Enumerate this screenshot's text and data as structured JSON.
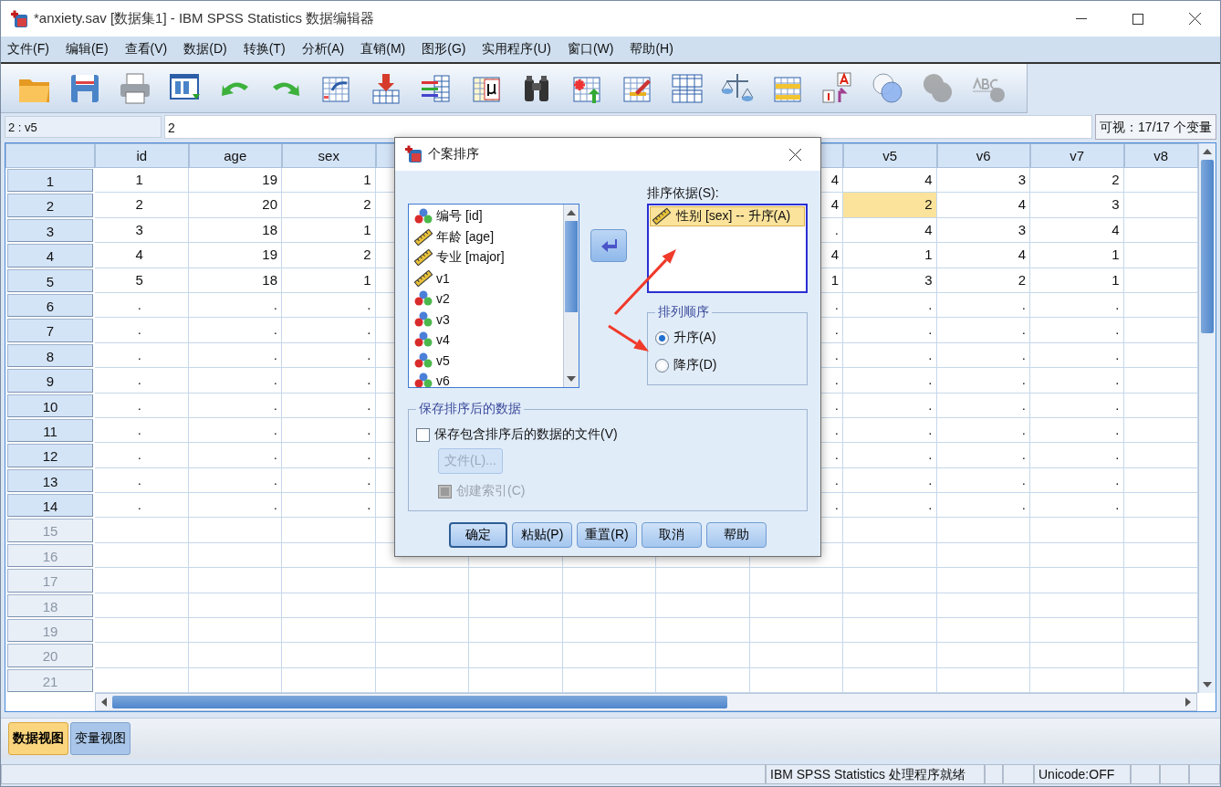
{
  "window": {
    "title": "*anxiety.sav [数据集1] - IBM SPSS Statistics 数据编辑器"
  },
  "menu": [
    "文件(F)",
    "编辑(E)",
    "查看(V)",
    "数据(D)",
    "转换(T)",
    "分析(A)",
    "直销(M)",
    "图形(G)",
    "实用程序(U)",
    "窗口(W)",
    "帮助(H)"
  ],
  "toolbar": [
    {
      "kind": "folder",
      "disabled": false
    },
    {
      "kind": "save",
      "disabled": false
    },
    {
      "kind": "print",
      "disabled": false
    },
    {
      "kind": "recall",
      "disabled": false
    },
    {
      "kind": "undo",
      "disabled": false
    },
    {
      "kind": "redo",
      "disabled": false
    },
    {
      "kind": "goto-case",
      "disabled": false
    },
    {
      "kind": "goto-variable",
      "disabled": false
    },
    {
      "kind": "variables",
      "disabled": false
    },
    {
      "kind": "mu",
      "disabled": false
    },
    {
      "kind": "find",
      "disabled": false
    },
    {
      "kind": "insert-case",
      "disabled": false
    },
    {
      "kind": "insert-variable",
      "disabled": false
    },
    {
      "kind": "split",
      "disabled": false
    },
    {
      "kind": "weight",
      "disabled": false
    },
    {
      "kind": "select",
      "disabled": false
    },
    {
      "kind": "labels",
      "disabled": false
    },
    {
      "kind": "sets",
      "disabled": false
    },
    {
      "kind": "sets-all",
      "disabled": true
    },
    {
      "kind": "spell",
      "disabled": true
    }
  ],
  "cell_editor": {
    "cell_name": "2 : v5",
    "value": "2",
    "visible_count": "可视：17/17 个变量"
  },
  "table": {
    "columns": [
      "id",
      "age",
      "sex",
      null,
      null,
      null,
      null,
      null,
      "v5",
      "v6",
      "v7",
      "v8"
    ],
    "rows": [
      {
        "number": "1",
        "kind": "data",
        "cells": [
          "1",
          "19",
          "1",
          null,
          null,
          null,
          null,
          "4",
          "4",
          "3",
          "2",
          null
        ]
      },
      {
        "number": "2",
        "kind": "data",
        "cells": [
          "2",
          "20",
          "2",
          null,
          null,
          null,
          null,
          "4",
          {
            "value": "2",
            "selected": true
          },
          "4",
          "3",
          null
        ]
      },
      {
        "number": "3",
        "kind": "data",
        "cells": [
          "3",
          "18",
          "1",
          null,
          null,
          null,
          null,
          ".",
          "4",
          "3",
          "4",
          null
        ]
      },
      {
        "number": "4",
        "kind": "data",
        "cells": [
          "4",
          "19",
          "2",
          null,
          null,
          null,
          null,
          "4",
          "1",
          "4",
          "1",
          null
        ]
      },
      {
        "number": "5",
        "kind": "data",
        "cells": [
          "5",
          "18",
          "1",
          null,
          null,
          null,
          null,
          "1",
          "3",
          "2",
          "1",
          null
        ]
      },
      {
        "number": "6",
        "kind": "data",
        "cells": [
          ".",
          ".",
          ".",
          null,
          null,
          null,
          null,
          ".",
          ".",
          ".",
          ".",
          null
        ]
      },
      {
        "number": "7",
        "kind": "data",
        "cells": [
          ".",
          ".",
          ".",
          null,
          null,
          null,
          null,
          ".",
          ".",
          ".",
          ".",
          null
        ]
      },
      {
        "number": "8",
        "kind": "data",
        "cells": [
          ".",
          ".",
          ".",
          null,
          null,
          null,
          null,
          ".",
          ".",
          ".",
          ".",
          null
        ]
      },
      {
        "number": "9",
        "kind": "data",
        "cells": [
          ".",
          ".",
          ".",
          null,
          null,
          null,
          null,
          ".",
          ".",
          ".",
          ".",
          null
        ]
      },
      {
        "number": "10",
        "kind": "data",
        "cells": [
          ".",
          ".",
          ".",
          null,
          null,
          null,
          null,
          ".",
          ".",
          ".",
          ".",
          null
        ]
      },
      {
        "number": "11",
        "kind": "data",
        "cells": [
          ".",
          ".",
          ".",
          null,
          null,
          null,
          null,
          ".",
          ".",
          ".",
          ".",
          null
        ]
      },
      {
        "number": "12",
        "kind": "data",
        "cells": [
          ".",
          ".",
          ".",
          null,
          null,
          null,
          null,
          ".",
          ".",
          ".",
          ".",
          null
        ]
      },
      {
        "number": "13",
        "kind": "data",
        "cells": [
          ".",
          ".",
          ".",
          null,
          null,
          null,
          null,
          ".",
          ".",
          ".",
          ".",
          null
        ]
      },
      {
        "number": "14",
        "kind": "data",
        "cells": [
          ".",
          ".",
          ".",
          null,
          null,
          null,
          null,
          ".",
          ".",
          ".",
          ".",
          null
        ]
      },
      {
        "number": "15",
        "kind": "blank"
      },
      {
        "number": "16",
        "kind": "blank"
      },
      {
        "number": "17",
        "kind": "blank"
      },
      {
        "number": "18",
        "kind": "blank"
      },
      {
        "number": "19",
        "kind": "blank"
      },
      {
        "number": "20",
        "kind": "blank"
      },
      {
        "number": "21",
        "kind": "blank"
      }
    ]
  },
  "dialog": {
    "title": "个案排序",
    "variables": [
      {
        "label": "编号 [id]",
        "kind": "nominal"
      },
      {
        "label": "年龄 [age]",
        "kind": "scale"
      },
      {
        "label": "专业 [major]",
        "kind": "scale"
      },
      {
        "label": "v1",
        "kind": "scale"
      },
      {
        "label": "v2",
        "kind": "nominal"
      },
      {
        "label": "v3",
        "kind": "nominal"
      },
      {
        "label": "v4",
        "kind": "nominal"
      },
      {
        "label": "v5",
        "kind": "nominal"
      },
      {
        "label": "v6",
        "kind": "nominal"
      }
    ],
    "sort_by_label": "排序依据(S):",
    "sort_by": [
      {
        "label": "性别 [sex] -- 升序(A)",
        "kind": "scale",
        "selected": true
      }
    ],
    "order_group": {
      "title": "排列顺序",
      "options": [
        {
          "label": "升序(A)",
          "selected": true
        },
        {
          "label": "降序(D)",
          "selected": false
        }
      ]
    },
    "save_group": {
      "title": "保存排序后的数据",
      "save_file": {
        "label": "保存包含排序后的数据的文件(V)",
        "checked": false,
        "disabled": false
      },
      "file_button": {
        "label": "文件(L)...",
        "disabled": true
      },
      "create_index": {
        "label": "创建索引(C)",
        "checked": false,
        "disabled": true
      }
    },
    "buttons": [
      {
        "label": "确定",
        "default": true
      },
      {
        "label": "粘贴(P)",
        "default": false
      },
      {
        "label": "重置(R)",
        "default": false
      },
      {
        "label": "取消",
        "default": false
      },
      {
        "label": "帮助",
        "default": false
      }
    ]
  },
  "view_tabs": [
    {
      "label": "数据视图",
      "selected": true
    },
    {
      "label": "变量视图",
      "selected": false
    }
  ],
  "status_bar": {
    "processor": "IBM SPSS Statistics 处理程序就绪",
    "unicode": "Unicode:OFF"
  }
}
